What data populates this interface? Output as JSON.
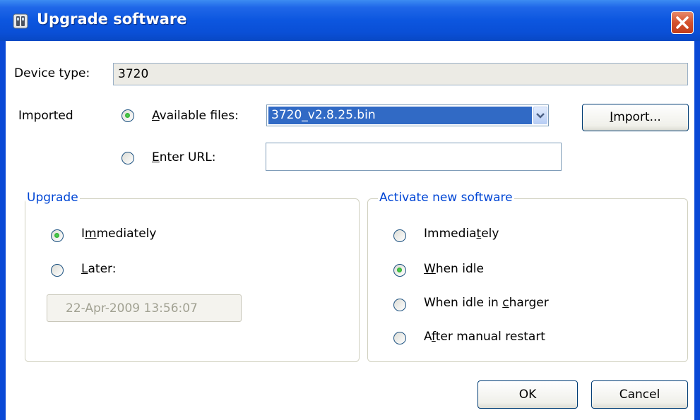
{
  "dialog": {
    "title": "Upgrade software"
  },
  "device": {
    "label": "Device type:",
    "value": "3720"
  },
  "source": {
    "imported_label": "Imported",
    "available_files_label_u": "A",
    "available_files_label_rest": "vailable files:",
    "selected_file": "3720_v2.8.25.bin",
    "enter_url_label_u": "E",
    "enter_url_label_rest": "nter URL:",
    "url_value": "",
    "import_button_u": "I",
    "import_button_rest": "mport...",
    "available_files_selected": true,
    "enter_url_selected": false
  },
  "upgrade": {
    "legend": "Upgrade",
    "immediately_pre": "I",
    "immediately_u": "m",
    "immediately_post": "mediately",
    "later_u": "L",
    "later_rest": "ater:",
    "date_value": "22-Apr-2009 13:56:07",
    "selected": "immediately"
  },
  "activate": {
    "legend": "Activate new software",
    "immediately_pre": "Immedia",
    "immediately_u": "t",
    "immediately_post": "ely",
    "when_idle_u": "W",
    "when_idle_rest": "hen idle",
    "when_idle_charger_pre": "When idle in ",
    "when_idle_charger_u": "c",
    "when_idle_charger_post": "harger",
    "after_restart_pre": "A",
    "after_restart_u": "f",
    "after_restart_post": "ter manual restart",
    "selected": "when_idle"
  },
  "buttons": {
    "ok": "OK",
    "cancel": "Cancel"
  },
  "colors": {
    "title_bar": "#0a4fd6",
    "selection": "#316ac5",
    "group_legend": "#0046d5"
  }
}
